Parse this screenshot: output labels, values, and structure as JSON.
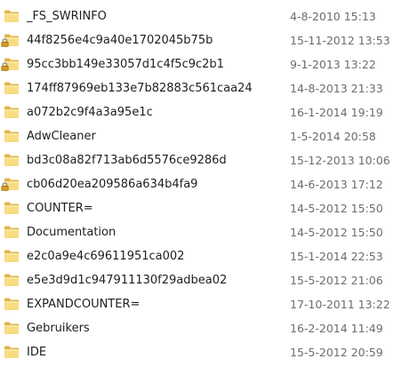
{
  "files": [
    {
      "name": "_FS_SWRINFO",
      "modified": "4-8-2010 15:13",
      "locked": false
    },
    {
      "name": "44f8256e4c9a40e1702045b75b",
      "modified": "15-11-2012 13:53",
      "locked": true
    },
    {
      "name": "95cc3bb149e33057d1c4f5c9c2b1",
      "modified": "9-1-2013 13:22",
      "locked": true
    },
    {
      "name": "174ff87969eb133e7b82883c561caa24",
      "modified": "14-8-2013 21:33",
      "locked": false
    },
    {
      "name": "a072b2c9f4a3a95e1c",
      "modified": "16-1-2014 19:19",
      "locked": false
    },
    {
      "name": "AdwCleaner",
      "modified": "1-5-2014 20:58",
      "locked": false
    },
    {
      "name": "bd3c08a82f713ab6d5576ce9286d",
      "modified": "15-12-2013 10:06",
      "locked": false
    },
    {
      "name": "cb06d20ea209586a634b4fa9",
      "modified": "14-6-2013 17:12",
      "locked": true
    },
    {
      "name": "COUNTER=",
      "modified": "14-5-2012 15:50",
      "locked": false
    },
    {
      "name": "Documentation",
      "modified": "14-5-2012 15:50",
      "locked": false
    },
    {
      "name": "e2c0a9e4c69611951ca002",
      "modified": "15-1-2014 22:53",
      "locked": false
    },
    {
      "name": "e5e3d9d1c947911130f29adbea02",
      "modified": "15-5-2012 21:06",
      "locked": false
    },
    {
      "name": "EXPANDCOUNTER=",
      "modified": "17-10-2011 13:22",
      "locked": false
    },
    {
      "name": "Gebruikers",
      "modified": "16-2-2014 11:49",
      "locked": false
    },
    {
      "name": "IDE",
      "modified": "15-5-2012 20:59",
      "locked": false
    }
  ],
  "icons": {
    "folder": "folder-icon",
    "lock": "lock-icon"
  },
  "colors": {
    "folder_light": "#f8dc85",
    "folder_dark": "#e0b44a",
    "name_text": "#1e1e1e",
    "date_text": "#6d6d6d"
  }
}
